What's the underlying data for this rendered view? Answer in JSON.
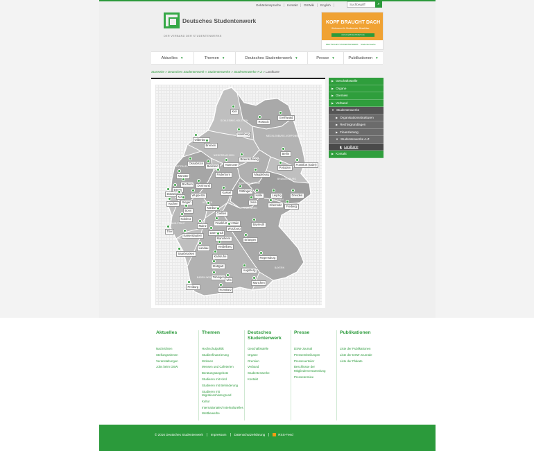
{
  "meta_links": [
    "Gebärdensprache",
    "Kontakt",
    "DSWiki",
    "English"
  ],
  "search": {
    "placeholder": "Suchbegriff",
    "button_icon": "search-icon"
  },
  "brand": {
    "name": "Deutsches Studentenwerk",
    "tagline": "DER VERBAND DER STUDENTENWERKE"
  },
  "ad": {
    "title": "KOPF BRAUCHT DACH",
    "subtitle": "Wohnraum für Studierende. Bezahlbar.",
    "url": "www.kopfbrauchtdach.de",
    "logo_left": "DEUTSCHES STUDENTENWERK",
    "logo_right": "Studentenwerke"
  },
  "nav": [
    {
      "label": "Aktuelles",
      "width": 62
    },
    {
      "label": "Themen",
      "width": 60
    },
    {
      "label": "Deutsches Studentenwerk",
      "width": 104
    },
    {
      "label": "Presse",
      "width": 52
    },
    {
      "label": "Publikationen",
      "width": 56
    }
  ],
  "breadcrumb": [
    "Startseite",
    "Deutsches Studentenwerk",
    "Studentenwerke",
    "Studentenwerke A-Z",
    "Landkarte"
  ],
  "map": {
    "regions": [
      "SCHLESWIG-HOLSTEIN",
      "MECKLENBURG-VORPOMMERN",
      "NIEDERSACHSEN",
      "NORDRHEIN-WESTFALEN",
      "BRANDENBURG",
      "SACHSEN-ANHALT",
      "HESSEN",
      "THÜRINGEN",
      "SACHSEN",
      "RHEINLAND-PFALZ",
      "SAARLAND",
      "BAYERN",
      "BADEN-WÜRTTEMBERG"
    ],
    "cities": [
      "Kiel",
      "Rostock",
      "Greifswald",
      "Hamburg",
      "Oldenburg",
      "Bremen",
      "Berlin",
      "Potsdam",
      "Frankfurt (Oder)",
      "Osnabrück",
      "Bielefeld",
      "Hannover",
      "Braunschweig",
      "Magdeburg",
      "Münster",
      "Paderborn",
      "Bochum",
      "Dortmund",
      "Essen",
      "Düsseldorf",
      "Wuppertal",
      "Köln",
      "Siegen",
      "Aachen",
      "Göttingen",
      "Kassel",
      "Halle",
      "Leipzig",
      "Dresden",
      "Chemnitz",
      "Jena",
      "Freiberg",
      "Bonn",
      "Marburg",
      "Gießen",
      "Koblenz",
      "Frankfurt am Main",
      "Mainz",
      "Trier",
      "Darmstadt",
      "Würzburg",
      "Bayreuth",
      "Kaiserslautern",
      "Mannheim",
      "Heidelberg",
      "Saarbrücken",
      "Landau",
      "Erlangen",
      "Karlsruhe",
      "Regensburg",
      "Stuttgart",
      "Tübingen",
      "Ulm",
      "Augsburg",
      "München",
      "Freiburg",
      "Konstanz"
    ]
  },
  "sidebar": [
    {
      "label": "Geschäftsstelle",
      "type": "green"
    },
    {
      "label": "Organe",
      "type": "green"
    },
    {
      "label": "Gremien",
      "type": "green"
    },
    {
      "label": "Verband",
      "type": "green"
    },
    {
      "label": "Studentenwerke",
      "type": "dark"
    },
    {
      "label": "Organisationsstrukturen",
      "type": "sub"
    },
    {
      "label": "Rechtsgrundlagen",
      "type": "sub"
    },
    {
      "label": "Finanzierung",
      "type": "sub"
    },
    {
      "label": "Studentenwerke A-Z",
      "type": "sub"
    },
    {
      "label": "Landkarte",
      "type": "subsub"
    },
    {
      "label": "Kontakt",
      "type": "green"
    }
  ],
  "footer": [
    {
      "title": "Aktuelles",
      "links": [
        "Nachrichten",
        "Stellungnahmen",
        "Veranstaltungen",
        "Jobs beim DSW"
      ]
    },
    {
      "title": "Themen",
      "links": [
        "Hochschulpolitik",
        "Studienfinanzierung",
        "Wohnen",
        "Mensen und Cafeterien",
        "Beratungsangebote",
        "Studieren mit Kind",
        "Studieren mit Behinderung",
        "Studieren mit Migrationshintergrund",
        "Kultur",
        "Internationales/ Interkulturelles",
        "Wettbewerbe"
      ]
    },
    {
      "title": "Deutsches Studentenwerk",
      "links": [
        "Geschäftsstelle",
        "Organe",
        "Gremien",
        "Verband",
        "Studentenwerke",
        "Kontakt"
      ]
    },
    {
      "title": "Presse",
      "links": [
        "DSW-Journal",
        "Pressemitteilungen",
        "Presseverteiler",
        "Beschlüsse der Mitgliederversammlung",
        "Pressetermine"
      ]
    },
    {
      "title": "Publikationen",
      "links": [
        "Liste der Publikationen",
        "Liste der DSW-Journale",
        "Liste der Plakate"
      ]
    }
  ],
  "bottom": {
    "copyright": "© 2016 Deutsches Studentenwerk",
    "impressum": "Impressum",
    "datenschutz": "Datenschutzerklärung",
    "rss": "RSS-Feed"
  },
  "colors": {
    "brand_green": "#2b9a3b",
    "sidebar_dark": "#555555"
  }
}
